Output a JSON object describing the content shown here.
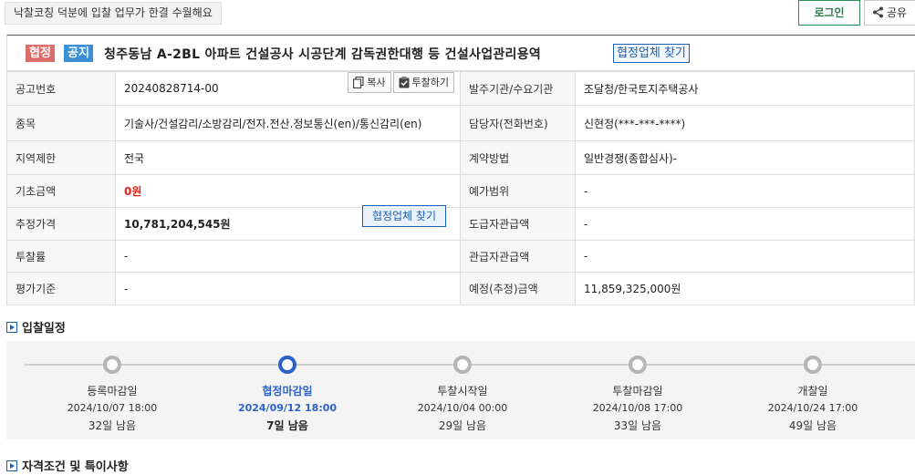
{
  "header": {
    "promo": "낙찰코칭 덕분에 입찰 업무가 한결 수월해요",
    "login": "로그인",
    "share": "공유",
    "share_icon": "share-icon"
  },
  "notice": {
    "status_tag": "협정",
    "type_tag": "공지",
    "title": "청주동남 A-2BL 아파트 건설공사 시공단계 감독권한대행 등 건설사업관리용역",
    "find_link": "협정업체 찾기"
  },
  "info": {
    "bid_no_label": "공고번호",
    "bid_no": "20240828714-00",
    "copy_label": "복사",
    "bid_label": "투찰하기",
    "org_label": "발주기관/수요기관",
    "org": "조달청/한국토지주택공사",
    "category_label": "종목",
    "category": "기술사/건설감리/소방감리/전자.전산.정보통신(en)/통신감리(en)",
    "manager_label": "담당자(전화번호)",
    "manager": "신현정(***-***-****)",
    "region_label": "지역제한",
    "region": "전국",
    "contract_label": "계약방법",
    "contract": "일반경쟁(종합심사)-",
    "base_label": "기초금액",
    "base": "0원",
    "range_label": "예가범위",
    "range": "-",
    "estimate_label": "추정가격",
    "estimate": "10,781,204,545원",
    "estimate_find": "협정업체 찾기",
    "supply_label": "도급자관급액",
    "supply": "-",
    "rate_label": "투찰률",
    "rate": "-",
    "govsupply_label": "관급자관급액",
    "govsupply": "-",
    "eval_label": "평가기준",
    "eval": "-",
    "planned_label": "예정(추정)금액",
    "planned": "11,859,325,000원"
  },
  "schedule": {
    "heading": "입찰일정",
    "steps": [
      {
        "name": "등록마감일",
        "date": "2024/10/07 18:00",
        "remain": "32일 남음",
        "active": false
      },
      {
        "name": "협정마감일",
        "date": "2024/09/12 18:00",
        "remain": "7일 남음",
        "active": true
      },
      {
        "name": "투찰시작일",
        "date": "2024/10/04 00:00",
        "remain": "29일 남음",
        "active": false
      },
      {
        "name": "투찰마감일",
        "date": "2024/10/08 17:00",
        "remain": "33일 남음",
        "active": false
      },
      {
        "name": "개찰일",
        "date": "2024/10/24 17:00",
        "remain": "49일 남음",
        "active": false
      }
    ]
  },
  "qualification": {
    "heading": "자격조건 및 특이사항"
  },
  "colors": {
    "accent": "#2c62c8",
    "price_red": "#e8231b",
    "login_green": "#2e7d4f"
  }
}
